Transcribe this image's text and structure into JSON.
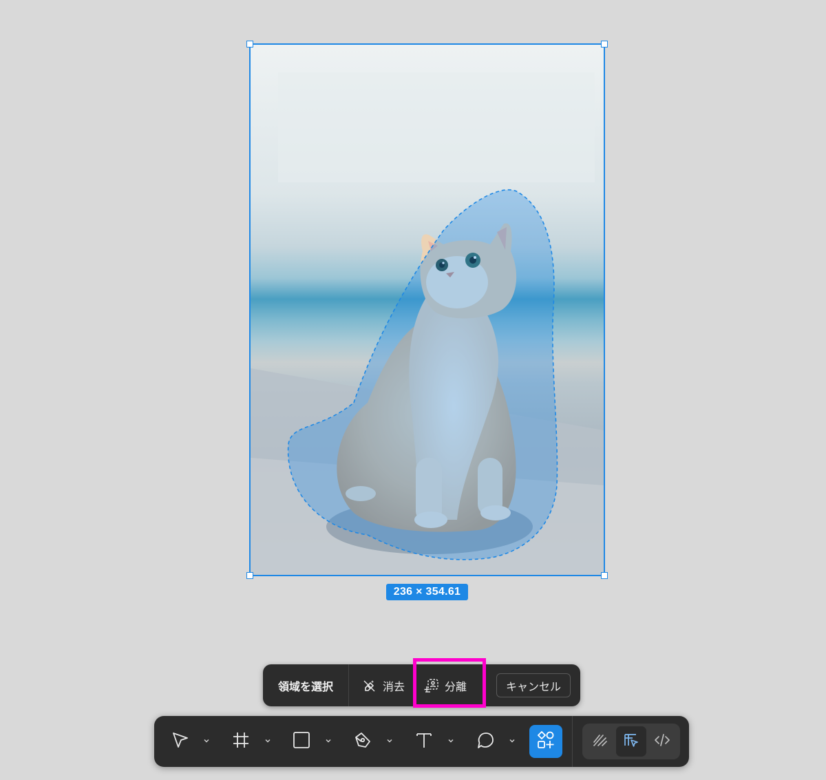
{
  "canvas": {
    "image_alt": "orange cat sitting and looking up",
    "dimension_label": "236 × 354.61"
  },
  "selection_bar": {
    "title": "領域を選択",
    "erase_label": "消去",
    "isolate_label": "分離",
    "cancel_label": "キャンセル"
  },
  "toolbar": {
    "tools": [
      {
        "name": "move-tool",
        "icon": "cursor-arrow-icon"
      },
      {
        "name": "frame-tool",
        "icon": "frame-hash-icon"
      },
      {
        "name": "shape-tool",
        "icon": "rectangle-icon"
      },
      {
        "name": "pen-tool",
        "icon": "pen-nib-icon"
      },
      {
        "name": "text-tool",
        "icon": "text-t-icon"
      },
      {
        "name": "comment-tool",
        "icon": "speech-bubble-icon"
      },
      {
        "name": "actions-tool",
        "icon": "components-plus-icon",
        "active": true
      }
    ],
    "modes": [
      {
        "name": "draw-mode",
        "icon": "scribble-icon"
      },
      {
        "name": "design-mode",
        "icon": "design-cursor-icon",
        "active": true
      },
      {
        "name": "dev-mode",
        "icon": "code-brackets-icon"
      }
    ]
  },
  "colors": {
    "selection": "#1e88e5",
    "toolbar_bg": "#2c2c2c",
    "highlight": "#ff00cc",
    "canvas_bg": "#d9d9d9"
  }
}
